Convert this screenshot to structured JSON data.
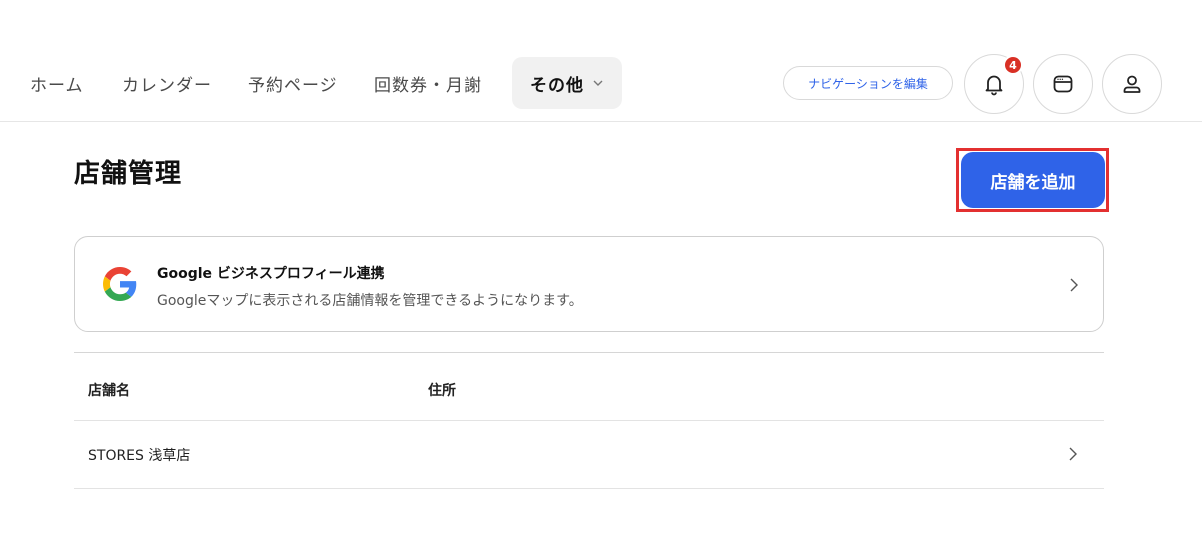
{
  "nav": {
    "items": [
      {
        "label": "ホーム"
      },
      {
        "label": "カレンダー"
      },
      {
        "label": "予約ページ"
      },
      {
        "label": "回数券・月謝"
      },
      {
        "label": "その他"
      }
    ],
    "edit_label": "ナビゲーションを編集",
    "notification_count": "4"
  },
  "main": {
    "title": "店舗管理",
    "add_button_label": "店舗を追加",
    "gbp": {
      "title": "Google ビジネスプロフィール連携",
      "description": "Googleマップに表示される店舗情報を管理できるようになります。"
    },
    "table": {
      "headers": [
        "店舗名",
        "住所"
      ],
      "rows": [
        {
          "name": "STORES 浅草店",
          "address": ""
        }
      ]
    }
  },
  "colors": {
    "accent": "#2f63e8",
    "badge": "#d93025",
    "highlight": "#e33030"
  }
}
